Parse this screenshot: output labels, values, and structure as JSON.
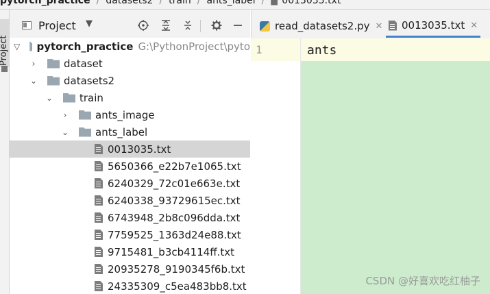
{
  "breadcrumb": [
    "pytorch_practice",
    "datasets2",
    "train",
    "ants_label",
    "0013035.txt"
  ],
  "sidebar_stripe": {
    "label": "Project"
  },
  "panel": {
    "title": "Project",
    "icons": [
      "view-icon",
      "chevron-down-icon",
      "locate-icon",
      "expand-all-icon",
      "collapse-all-icon",
      "gear-icon",
      "minimize-icon"
    ]
  },
  "tree": {
    "root": {
      "name": "pytorch_practice",
      "path": "G:\\PythonProject\\pyto"
    },
    "dataset": "dataset",
    "datasets2": "datasets2",
    "train": "train",
    "ants_image": "ants_image",
    "ants_label": "ants_label",
    "files": [
      "0013035.txt",
      "5650366_e22b7e1065.txt",
      "6240329_72c01e663e.txt",
      "6240338_93729615ec.txt",
      "6743948_2b8c096dda.txt",
      "7759525_1363d24e88.txt",
      "9715481_b3cb4114ff.txt",
      "20935278_9190345f6b.txt",
      "24335309_c5ea483bb8.txt"
    ],
    "selected_file": "0013035.txt"
  },
  "editor": {
    "tabs": [
      {
        "label": "read_datasets2.py",
        "active": false
      },
      {
        "label": "0013035.txt",
        "active": true
      }
    ],
    "line_number": "1",
    "content": "ants"
  },
  "watermark": "CSDN @好喜欢吃红柚子",
  "colors": {
    "code_bg": "#cdeccd",
    "current_line": "#fcfbe3",
    "selection": "#d5d5d5",
    "tab_accent": "#4083c9"
  }
}
